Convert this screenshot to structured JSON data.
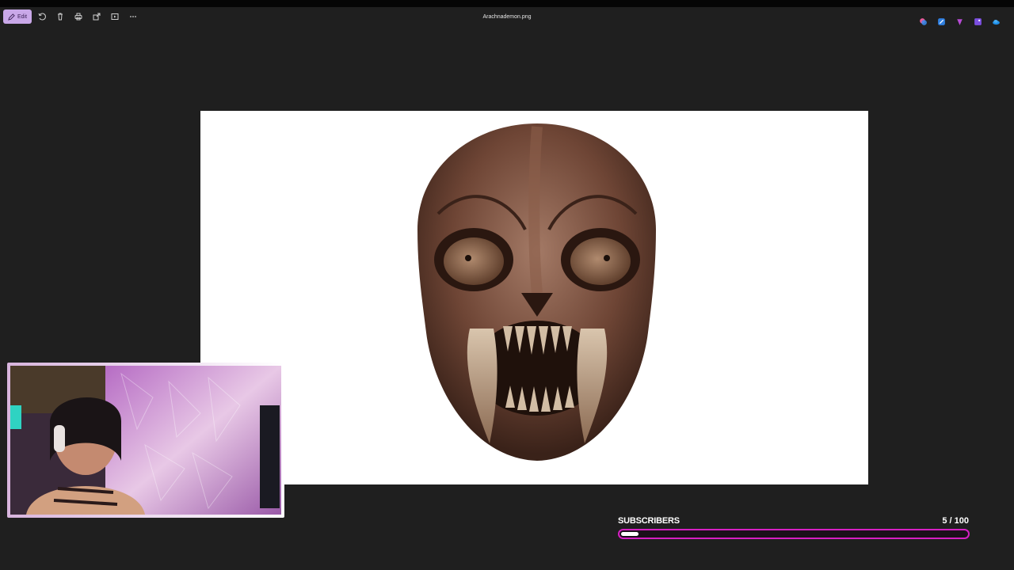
{
  "toolbar": {
    "edit_label": "Edit",
    "left_icons": [
      "rotate-icon",
      "delete-icon",
      "print-icon",
      "share-icon",
      "slideshow-icon",
      "more-icon"
    ],
    "right_icons": [
      "copilot-icon",
      "designer-icon",
      "clipchamp-icon",
      "photos-icon",
      "onedrive-icon"
    ]
  },
  "window": {
    "file_name": "Arachnademon.png"
  },
  "image": {
    "description_icon": "demon-mask-image"
  },
  "overlay": {
    "subscribers_label": "SUBSCRIBERS",
    "subscribers_count_text": "5  / 100",
    "subscribers_current": 5,
    "subscribers_goal": 100,
    "bar_color": "#d61fc3"
  },
  "colors": {
    "accent": "#c9a8e8",
    "background": "#1f1f1f"
  }
}
